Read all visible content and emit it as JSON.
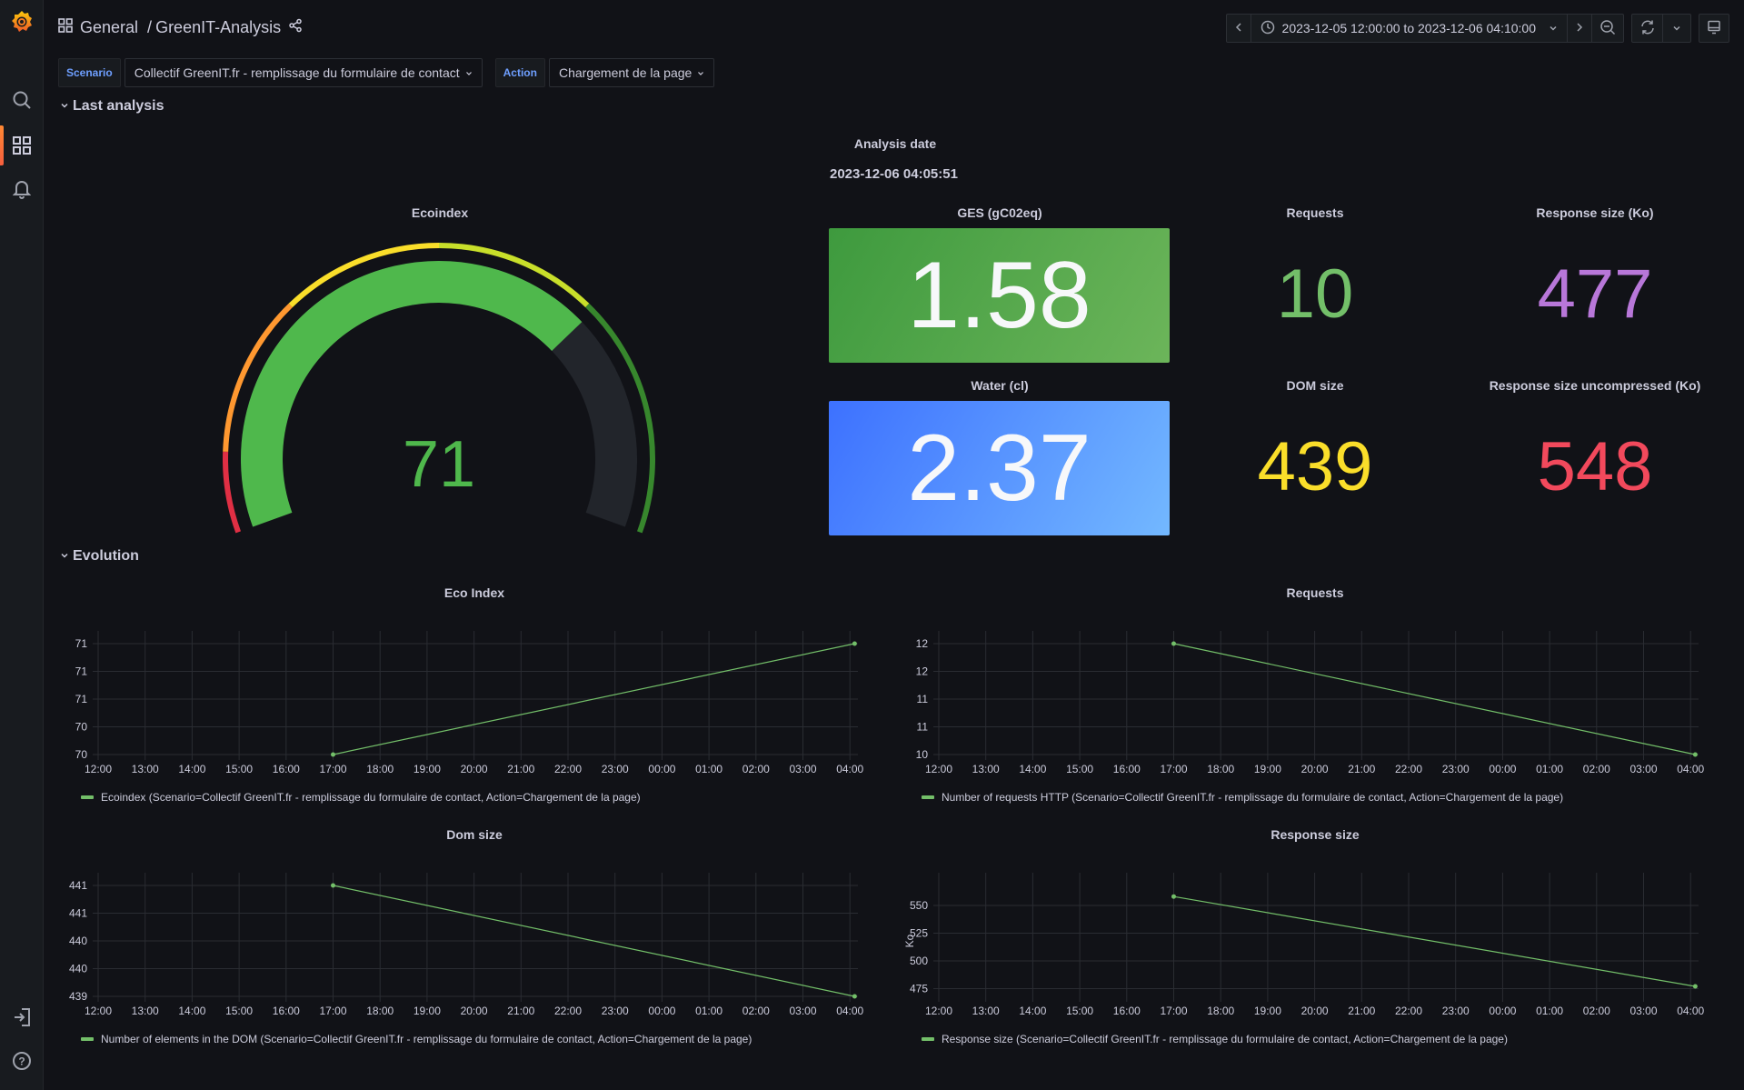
{
  "header": {
    "breadcrumb_root": "General",
    "breadcrumb_sep": "/",
    "dashboard_title": "GreenIT-Analysis",
    "time_range": "2023-12-05 12:00:00 to 2023-12-06 04:10:00"
  },
  "variables": [
    {
      "label": "Scenario",
      "value": "Collectif GreenIT.fr - remplissage du formulaire de contact"
    },
    {
      "label": "Action",
      "value": "Chargement de la page"
    }
  ],
  "rows": {
    "last_analysis": "Last analysis",
    "evolution": "Evolution"
  },
  "analysis_date": {
    "title": "Analysis date",
    "value": "2023-12-06 04:05:51"
  },
  "gauge": {
    "title": "Ecoindex",
    "value": 71,
    "min": 0,
    "max": 100,
    "value_color": "#4fb84c",
    "thresholds": [
      {
        "from": 0,
        "to": 10,
        "color": "#e02f44"
      },
      {
        "from": 10,
        "to": 30,
        "color": "#ff9830"
      },
      {
        "from": 30,
        "to": 50,
        "color": "#fade2a"
      },
      {
        "from": 50,
        "to": 70,
        "color": "#c8df2a"
      },
      {
        "from": 70,
        "to": 100,
        "color": "#37872d"
      }
    ]
  },
  "stats": {
    "ges": {
      "title": "GES (gC02eq)",
      "value": "1.58",
      "color_from": "#3e9a3e",
      "color_to": "#6cb55a"
    },
    "water": {
      "title": "Water (cl)",
      "value": "2.37",
      "color_from": "#3d71ff",
      "color_to": "#73b8ff"
    },
    "requests": {
      "title": "Requests",
      "value": "10",
      "color": "#73bf69"
    },
    "response_size": {
      "title": "Response size (Ko)",
      "value": "477",
      "color": "#b877d9"
    },
    "dom_size": {
      "title": "DOM size",
      "value": "439",
      "color": "#fade2a"
    },
    "response_size_uncompressed": {
      "title": "Response size uncompressed (Ko)",
      "value": "548",
      "color": "#f2495c"
    }
  },
  "chart_data": [
    {
      "type": "line",
      "title": "Eco Index",
      "x_ticks": [
        "12:00",
        "13:00",
        "14:00",
        "15:00",
        "16:00",
        "17:00",
        "18:00",
        "19:00",
        "20:00",
        "21:00",
        "22:00",
        "23:00",
        "00:00",
        "01:00",
        "02:00",
        "03:00",
        "04:00"
      ],
      "y_ticks": [
        "71",
        "71",
        "71",
        "70",
        "70"
      ],
      "ylabel": "",
      "x": [
        17.0,
        28.1
      ],
      "values": [
        70.0,
        71.0
      ],
      "ylim": [
        70.0,
        71.0
      ],
      "xlim": [
        12.0,
        28.17
      ],
      "series_name": "Ecoindex (Scenario=Collectif GreenIT.fr - remplissage du formulaire de contact, Action=Chargement de la page)",
      "color": "#73bf69"
    },
    {
      "type": "line",
      "title": "Requests",
      "x_ticks": [
        "12:00",
        "13:00",
        "14:00",
        "15:00",
        "16:00",
        "17:00",
        "18:00",
        "19:00",
        "20:00",
        "21:00",
        "22:00",
        "23:00",
        "00:00",
        "01:00",
        "02:00",
        "03:00",
        "04:00"
      ],
      "y_ticks": [
        "12",
        "12",
        "11",
        "11",
        "10"
      ],
      "ylabel": "",
      "x": [
        17.0,
        28.1
      ],
      "values": [
        12,
        10
      ],
      "ylim": [
        10,
        12
      ],
      "xlim": [
        12.0,
        28.17
      ],
      "series_name": "Number of requests HTTP (Scenario=Collectif GreenIT.fr - remplissage du formulaire de contact, Action=Chargement de la page)",
      "color": "#73bf69"
    },
    {
      "type": "line",
      "title": "Dom size",
      "x_ticks": [
        "12:00",
        "13:00",
        "14:00",
        "15:00",
        "16:00",
        "17:00",
        "18:00",
        "19:00",
        "20:00",
        "21:00",
        "22:00",
        "23:00",
        "00:00",
        "01:00",
        "02:00",
        "03:00",
        "04:00"
      ],
      "y_ticks": [
        "441",
        "441",
        "440",
        "440",
        "439"
      ],
      "ylabel": "",
      "x": [
        17.0,
        28.1
      ],
      "values": [
        441,
        439
      ],
      "ylim": [
        439,
        441
      ],
      "xlim": [
        12.0,
        28.17
      ],
      "series_name": "Number of elements in the DOM (Scenario=Collectif GreenIT.fr - remplissage du formulaire de contact, Action=Chargement de la page)",
      "color": "#73bf69"
    },
    {
      "type": "line",
      "title": "Response size",
      "x_ticks": [
        "12:00",
        "13:00",
        "14:00",
        "15:00",
        "16:00",
        "17:00",
        "18:00",
        "19:00",
        "20:00",
        "21:00",
        "22:00",
        "23:00",
        "00:00",
        "01:00",
        "02:00",
        "03:00",
        "04:00"
      ],
      "y_ticks": [
        "550",
        "525",
        "500",
        "475"
      ],
      "ylabel": "Ko",
      "x": [
        17.0,
        28.1
      ],
      "values": [
        558,
        477
      ],
      "ylim": [
        468,
        568
      ],
      "y_tick_values": [
        550,
        525,
        500,
        475
      ],
      "xlim": [
        12.0,
        28.17
      ],
      "series_name": "Response size (Scenario=Collectif GreenIT.fr - remplissage du formulaire de contact, Action=Chargement de la page)",
      "color": "#73bf69"
    }
  ]
}
